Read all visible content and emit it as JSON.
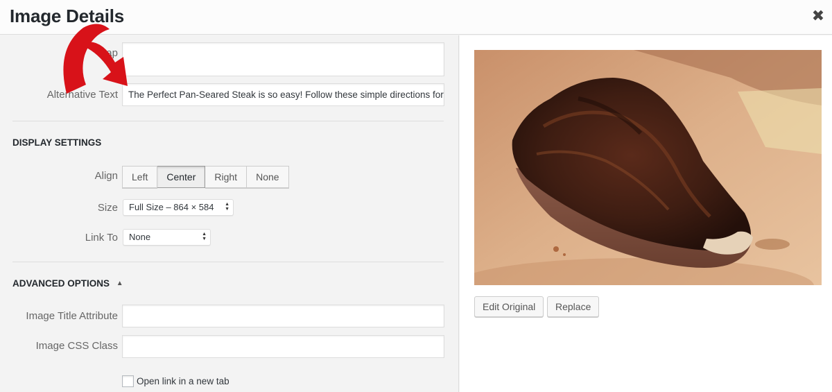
{
  "header": {
    "title": "Image Details",
    "close_glyph": "✖"
  },
  "fields": {
    "caption_label": "Cap",
    "caption_value": "",
    "alt_label": "Alternative Text",
    "alt_value": "The Perfect Pan-Seared Steak is so easy! Follow these simple directions for t"
  },
  "display_settings": {
    "heading": "DISPLAY SETTINGS",
    "align_label": "Align",
    "align_options": [
      "Left",
      "Center",
      "Right",
      "None"
    ],
    "align_selected": "Center",
    "size_label": "Size",
    "size_value": "Full Size – 864 × 584",
    "link_label": "Link To",
    "link_value": "None"
  },
  "advanced": {
    "heading": "ADVANCED OPTIONS",
    "toggle_glyph": "▲",
    "title_attr_label": "Image Title Attribute",
    "title_attr_value": "",
    "css_class_label": "Image CSS Class",
    "css_class_value": "",
    "new_tab_label": "Open link in a new tab",
    "new_tab_checked": false
  },
  "preview": {
    "edit_label": "Edit Original",
    "replace_label": "Replace"
  },
  "colors": {
    "annotation_arrow": "#d81219",
    "accent_border": "#dddddd"
  },
  "icons": {
    "close": "close-icon",
    "select_arrows": "updown-arrows-icon",
    "annotation": "red-arrow-annotation"
  }
}
